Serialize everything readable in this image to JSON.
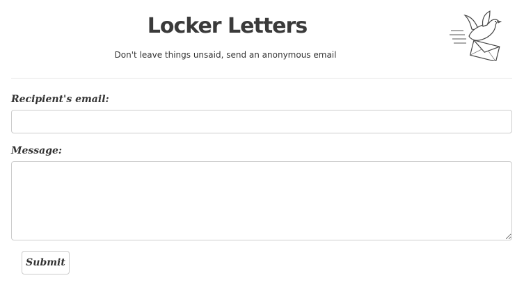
{
  "header": {
    "title": "Locker Letters",
    "subtitle": "Don't leave things unsaid, send an anonymous email",
    "logo_icon": "dove-envelope-icon"
  },
  "form": {
    "email_label": "Recipient's email:",
    "email_value": "",
    "message_label": "Message:",
    "message_value": "",
    "submit_label": "Submit"
  },
  "colors": {
    "text": "#333333",
    "border": "#cccccc",
    "divider": "#e6e6e6",
    "background": "#ffffff"
  }
}
